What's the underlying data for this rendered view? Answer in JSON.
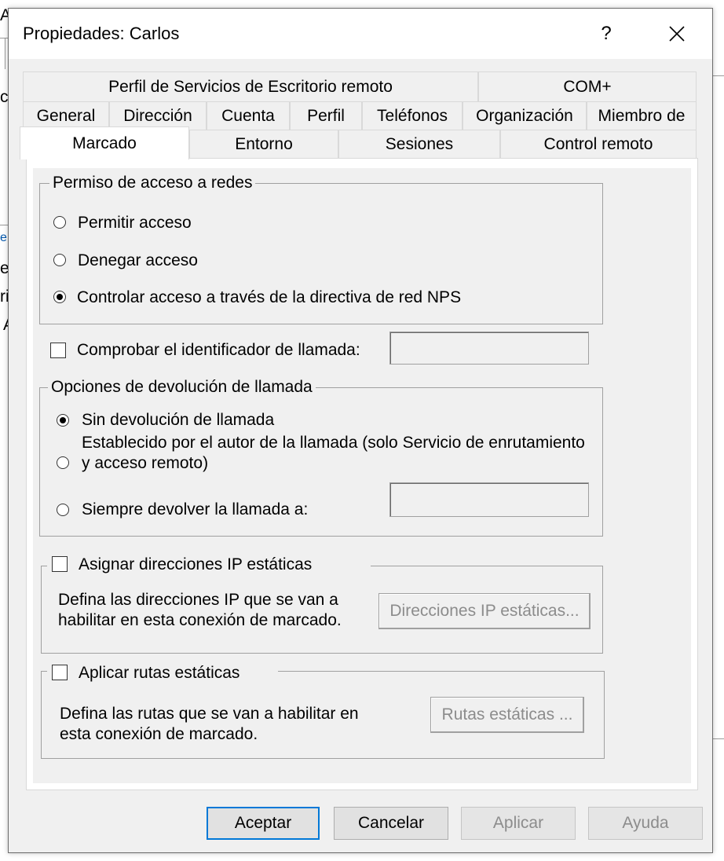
{
  "background_fragments": [
    "A",
    "ct",
    "er",
    "ri",
    "A",
    "e s"
  ],
  "dialog": {
    "title": "Propiedades: Carlos",
    "help_label": "?",
    "close_icon": "close-icon"
  },
  "tabs": {
    "row1": [
      "Perfil de Servicios de Escritorio remoto",
      "COM+"
    ],
    "row2": [
      "General",
      "Dirección",
      "Cuenta",
      "Perfil",
      "Teléfonos",
      "Organización",
      "Miembro de"
    ],
    "row3": [
      "Marcado",
      "Entorno",
      "Sesiones",
      "Control remoto"
    ],
    "active": "Marcado"
  },
  "network_access": {
    "legend": "Permiso de acceso a redes",
    "options": [
      "Permitir acceso",
      "Denegar acceso",
      "Controlar acceso a través de la directiva de red NPS"
    ],
    "selected": "Controlar acceso a través de la directiva de red NPS"
  },
  "caller_id": {
    "label": "Comprobar el identificador de llamada:",
    "checked": false,
    "value": ""
  },
  "callback": {
    "legend": "Opciones de devolución de llamada",
    "options": [
      "Sin devolución de llamada",
      "Establecido por el autor de la llamada (solo Servicio de enrutamiento y acceso remoto)",
      "Siempre devolver la llamada a:"
    ],
    "selected": "Sin devolución de llamada",
    "value": ""
  },
  "static_ip": {
    "label": "Asignar direcciones IP estáticas",
    "checked": false,
    "description": "Defina las direcciones IP que se van a habilitar en esta conexión de marcado.",
    "button": "Direcciones IP estáticas..."
  },
  "static_routes": {
    "label": "Aplicar rutas estáticas",
    "checked": false,
    "description": "Defina las rutas que se van a habilitar en esta conexión de marcado.",
    "button": "Rutas estáticas ..."
  },
  "buttons": {
    "ok": "Aceptar",
    "cancel": "Cancelar",
    "apply": "Aplicar",
    "help": "Ayuda"
  }
}
